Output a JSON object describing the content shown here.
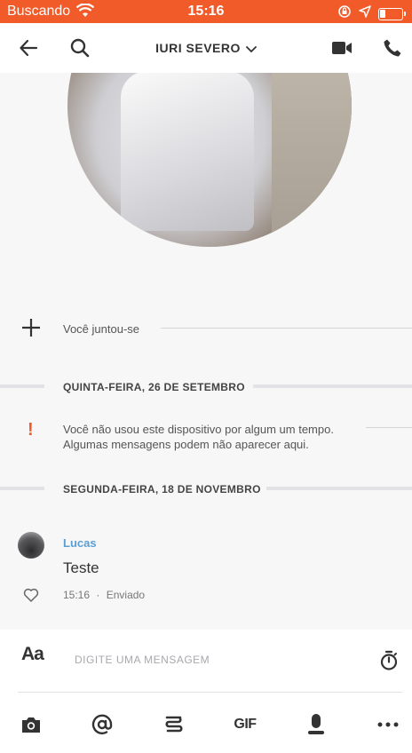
{
  "status_bar": {
    "carrier": "Buscando",
    "time": "15:16",
    "battery_level": 0.25
  },
  "header": {
    "title": "IURI SEVERO",
    "icons": [
      "back-arrow-icon",
      "search-icon",
      "chevron-down-icon",
      "video-call-icon",
      "phone-icon"
    ]
  },
  "conversation": {
    "joined_text": "Você juntou-se",
    "date_1": "QUINTA-FEIRA, 26 DE SETEMBRO",
    "warning_line_1": "Você não usou este dispositivo por algum um tempo.",
    "warning_line_2": "Algumas mensagens podem não aparecer aqui.",
    "date_2": "SEGUNDA-FEIRA, 18 DE NOVEMBRO",
    "message": {
      "sender": "Lucas",
      "text": "Teste",
      "time": "15:16",
      "separator": "·",
      "status": "Enviado"
    }
  },
  "composer": {
    "format_label": "Aa",
    "placeholder": "DIGITE UMA MENSAGEM",
    "value": "",
    "toolbar": {
      "gif_label": "GIF",
      "icons": [
        "camera-icon",
        "mention-icon",
        "sketch-icon",
        "gif-icon",
        "microphone-icon",
        "more-icon"
      ]
    }
  },
  "colors": {
    "accent": "#f15a29",
    "sender": "#5a9fd4",
    "background": "#f7f7f8"
  }
}
